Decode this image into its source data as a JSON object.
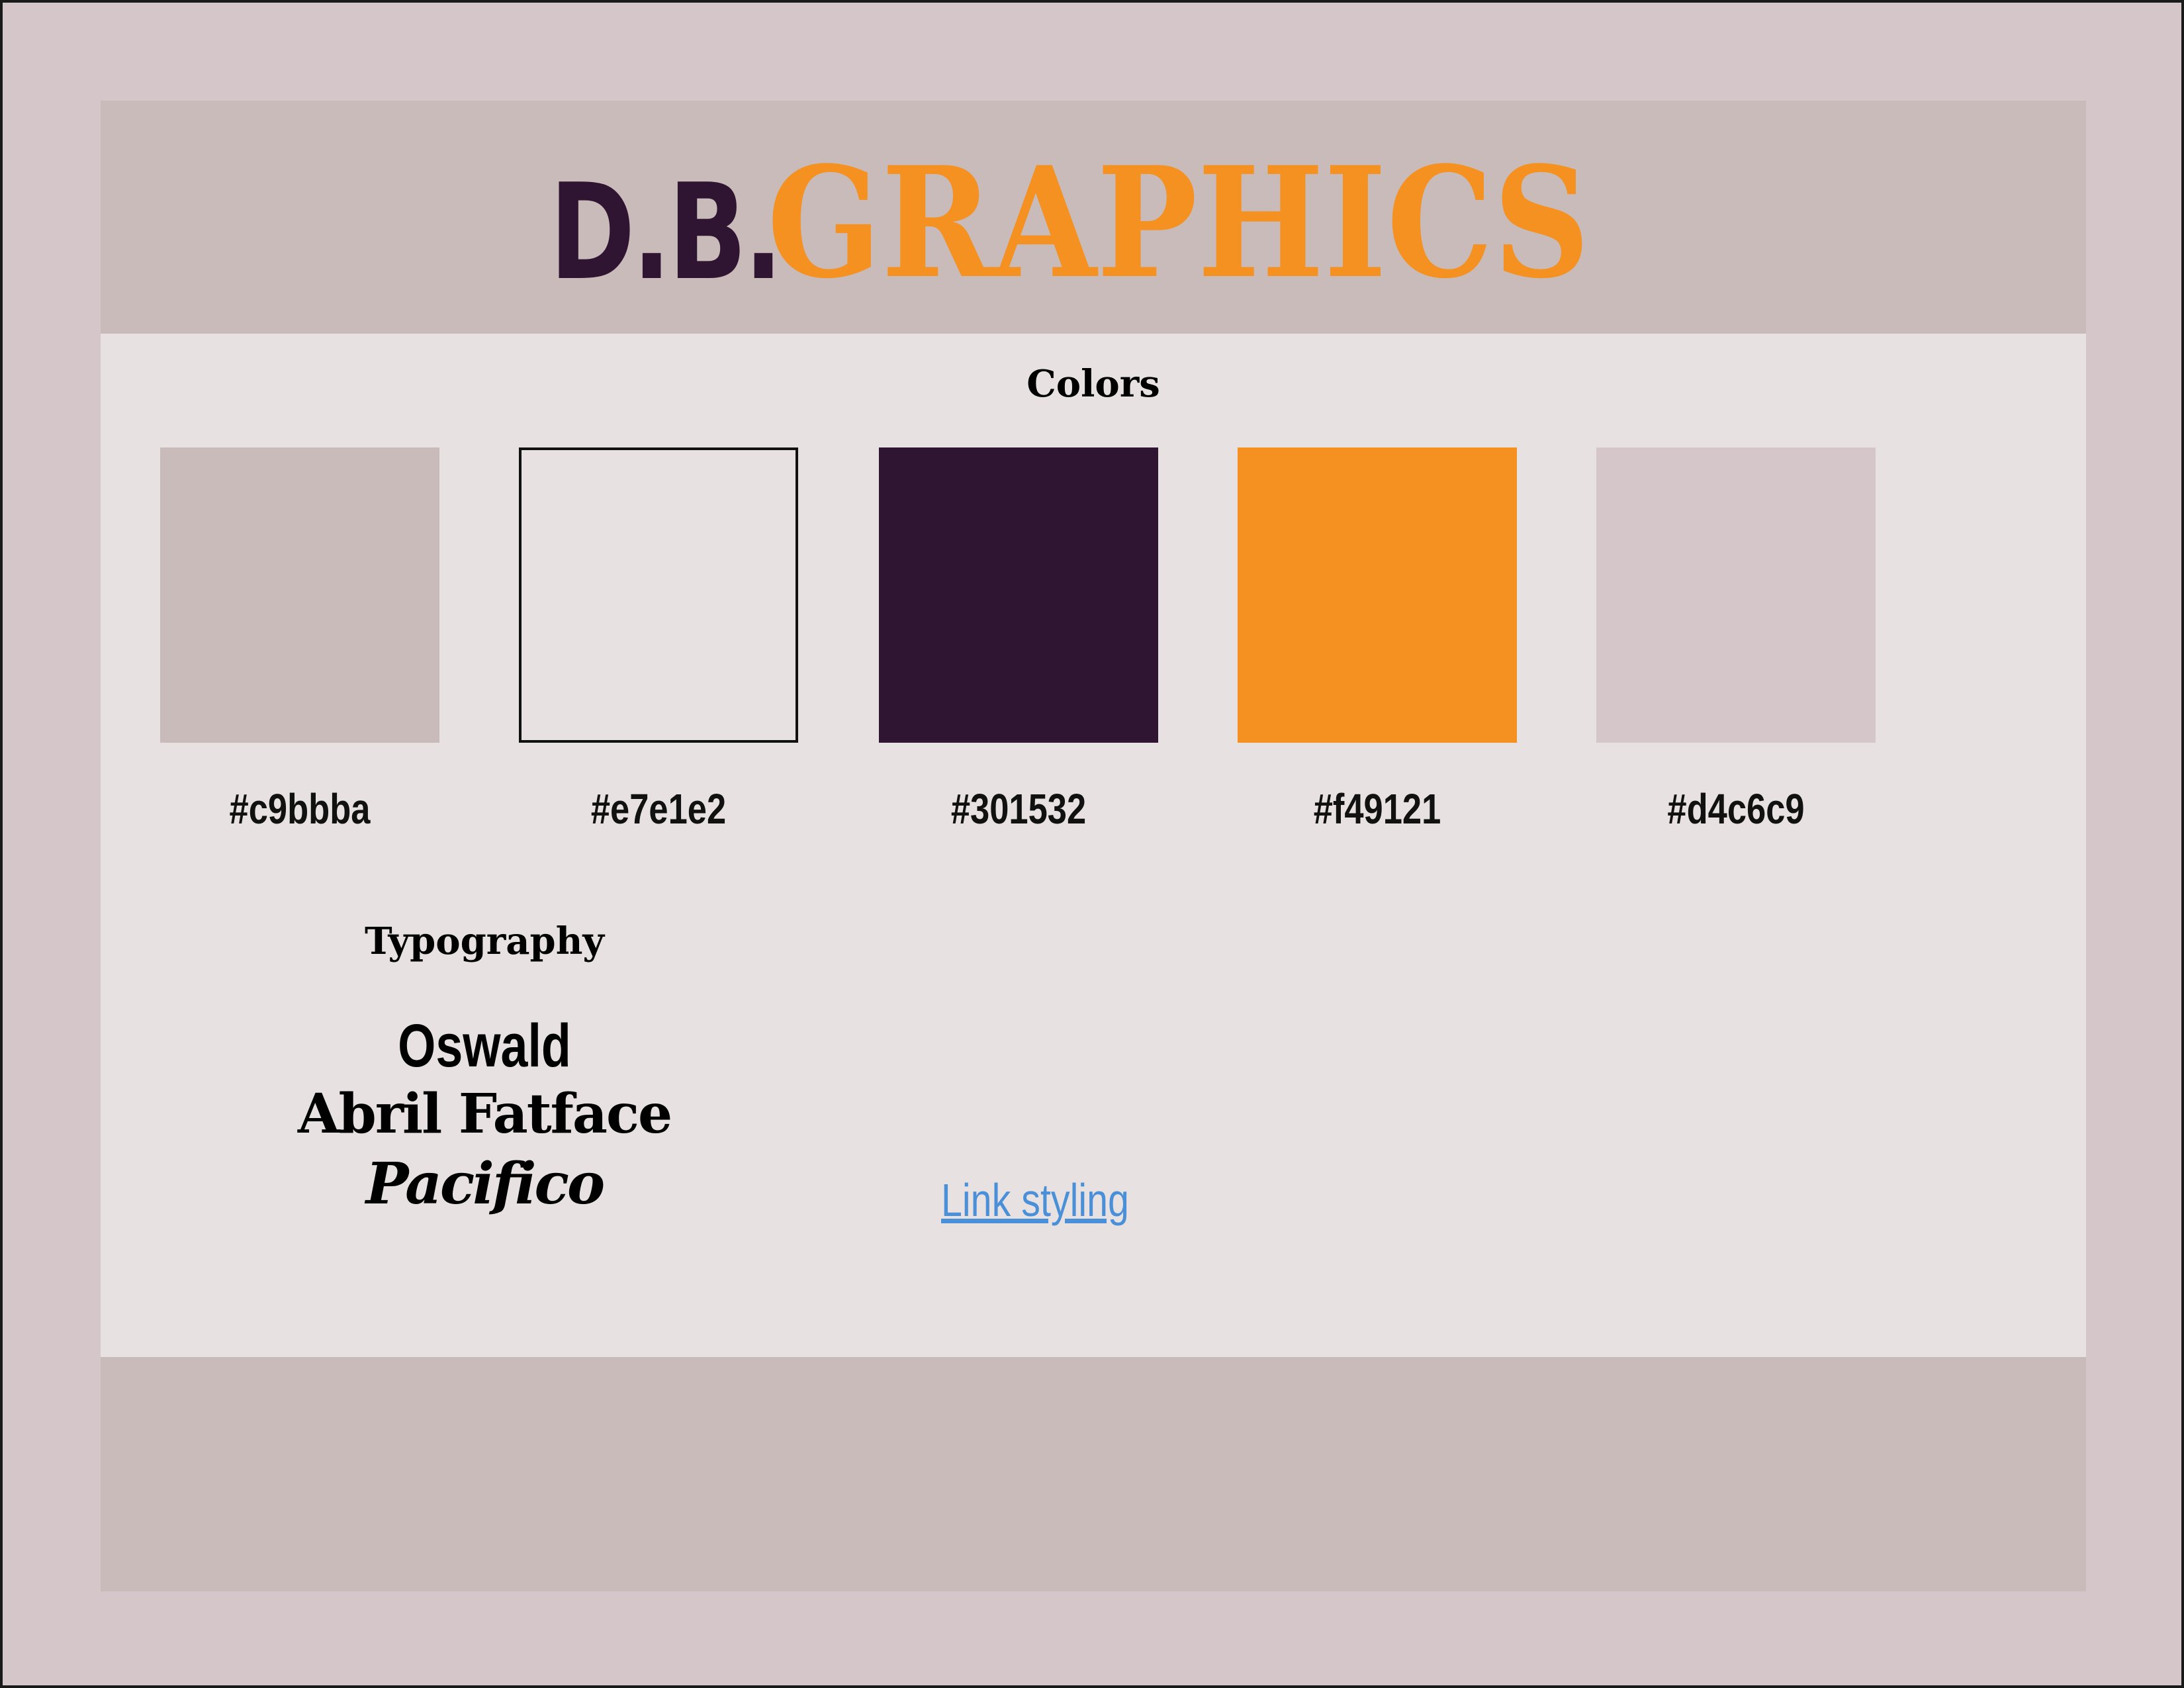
{
  "header": {
    "logo_primary": "D.B.",
    "logo_secondary": "GRAPHICS"
  },
  "colors_section": {
    "title": "Colors",
    "swatches": [
      {
        "hex": "#c9bbba",
        "label": "#c9bbba"
      },
      {
        "hex": "#e7e1e2",
        "label": "#e7e1e2"
      },
      {
        "hex": "#301532",
        "label": "#301532"
      },
      {
        "hex": "#f49121",
        "label": "#f49121"
      },
      {
        "hex": "#d4c6c9",
        "label": "#d4c6c9"
      }
    ]
  },
  "typography_section": {
    "title": "Typography",
    "fonts": [
      "Oswald",
      "Abril Fatface",
      "Pacifico"
    ]
  },
  "link_sample": {
    "label": "Link styling",
    "color": "#4a90d9"
  },
  "theme": {
    "page_background": "#d4c6c9",
    "header_footer_background": "#c9bbba",
    "content_background": "#e7e1e2",
    "brand_dark": "#301532",
    "brand_orange": "#f49121"
  }
}
